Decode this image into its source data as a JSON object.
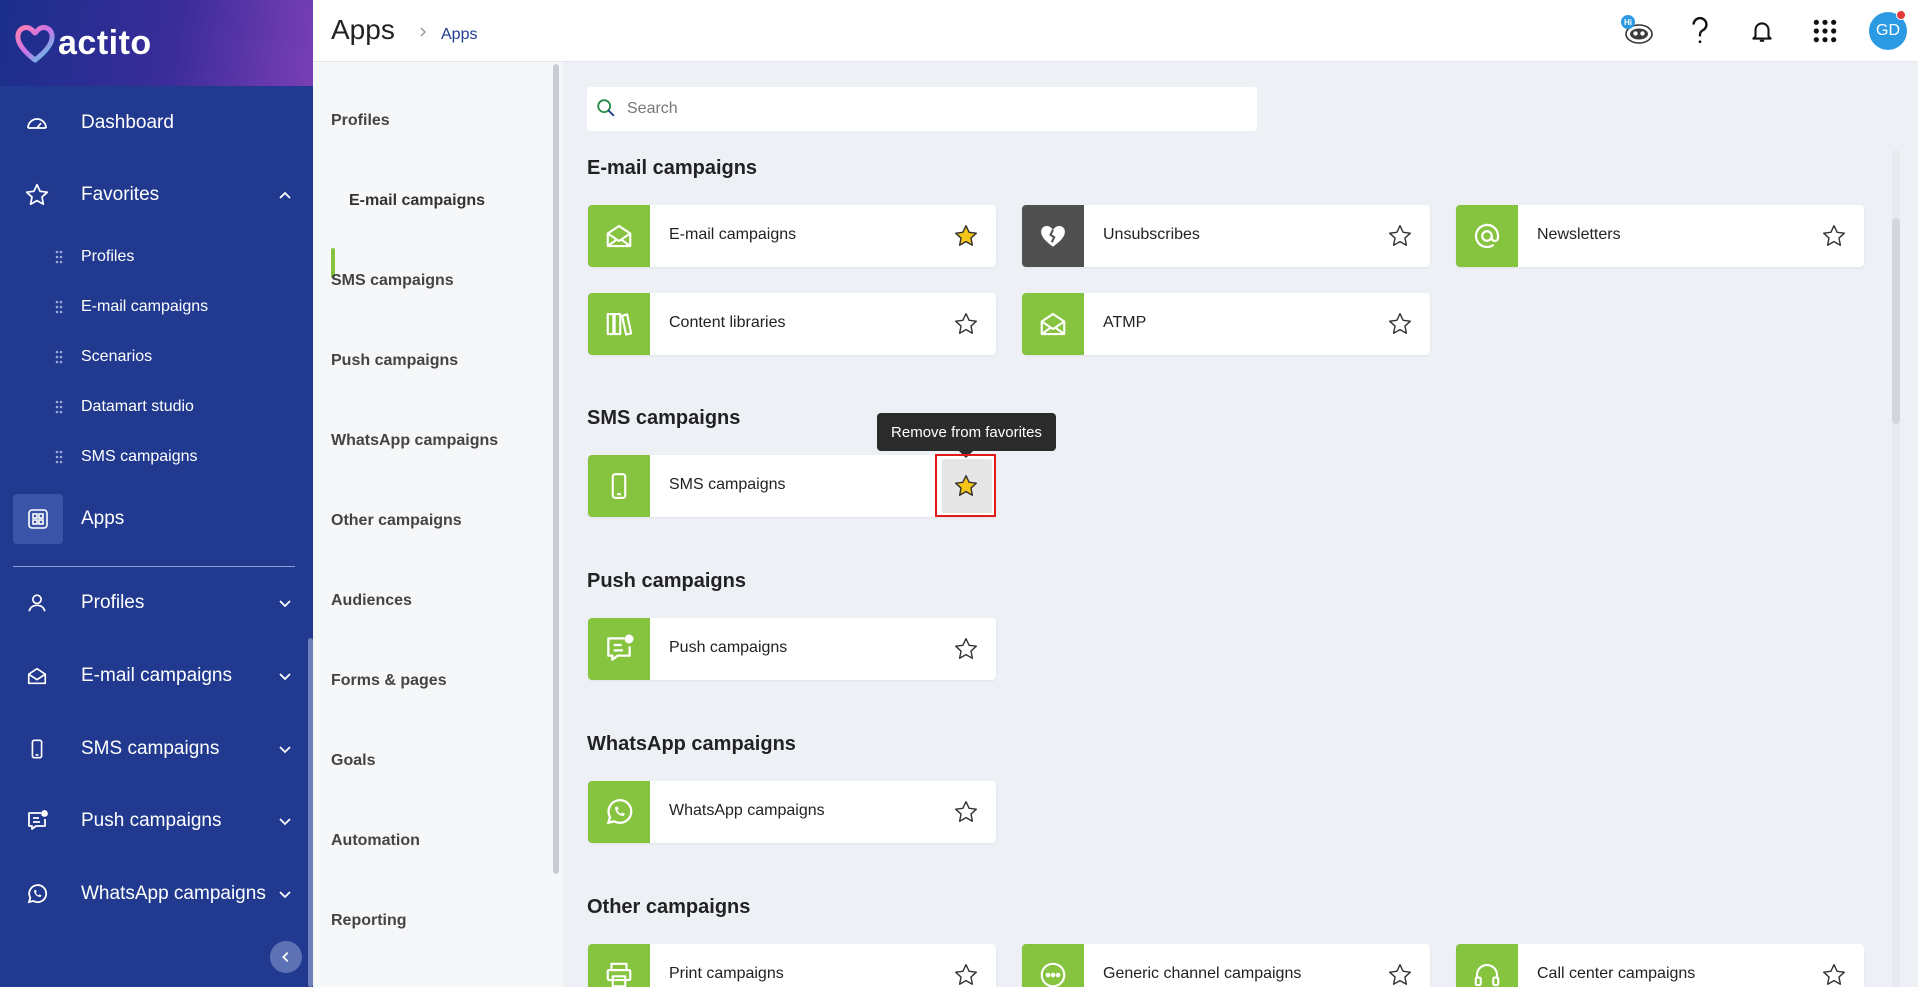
{
  "brand": {
    "name": "actito"
  },
  "colors": {
    "sidebar": "#213a8f",
    "accent_green": "#86c440",
    "avatar": "#2c9ae3",
    "tooltip": "#2b2b2b",
    "highlight_red": "#e01b1b",
    "star_fill": "#f5c518"
  },
  "sidebar": {
    "dashboard": {
      "label": "Dashboard",
      "icon": "gauge-icon"
    },
    "favorites": {
      "label": "Favorites",
      "icon": "star-icon",
      "expanded": true,
      "items": [
        {
          "label": "Profiles"
        },
        {
          "label": "E-mail campaigns"
        },
        {
          "label": "Scenarios"
        },
        {
          "label": "Datamart studio"
        },
        {
          "label": "SMS campaigns"
        }
      ]
    },
    "apps": {
      "label": "Apps",
      "icon": "apps-grid-icon"
    },
    "sections": [
      {
        "label": "Profiles",
        "icon": "user-icon"
      },
      {
        "label": "E-mail campaigns",
        "icon": "envelope-icon"
      },
      {
        "label": "SMS campaigns",
        "icon": "mobile-icon"
      },
      {
        "label": "Push campaigns",
        "icon": "push-message-icon"
      },
      {
        "label": "WhatsApp campaigns",
        "icon": "whatsapp-icon"
      }
    ]
  },
  "header": {
    "title": "Apps",
    "breadcrumb": "Apps",
    "avatar_initials": "GD",
    "badge_text": "Hi"
  },
  "categories": {
    "active": "E-mail campaigns",
    "items": [
      {
        "label": "Profiles"
      },
      {
        "label": "E-mail campaigns"
      },
      {
        "label": "SMS campaigns"
      },
      {
        "label": "Push campaigns"
      },
      {
        "label": "WhatsApp campaigns"
      },
      {
        "label": "Other campaigns"
      },
      {
        "label": "Audiences"
      },
      {
        "label": "Forms & pages"
      },
      {
        "label": "Goals"
      },
      {
        "label": "Automation"
      },
      {
        "label": "Reporting"
      }
    ]
  },
  "search": {
    "placeholder": "Search",
    "value": ""
  },
  "sections": {
    "email": {
      "title": "E-mail campaigns",
      "apps": [
        {
          "label": "E-mail campaigns",
          "icon": "envelope-icon",
          "favorite": true
        },
        {
          "label": "Unsubscribes",
          "icon": "broken-heart-icon",
          "favorite": false
        },
        {
          "label": "Newsletters",
          "icon": "at-sign-icon",
          "favorite": false
        },
        {
          "label": "Content libraries",
          "icon": "books-icon",
          "favorite": false
        },
        {
          "label": "ATMP",
          "icon": "envelope-icon",
          "favorite": false
        }
      ]
    },
    "sms": {
      "title": "SMS campaigns",
      "apps": [
        {
          "label": "SMS campaigns",
          "icon": "mobile-icon",
          "favorite": true
        }
      ]
    },
    "push": {
      "title": "Push campaigns",
      "apps": [
        {
          "label": "Push campaigns",
          "icon": "push-message-icon",
          "favorite": false
        }
      ]
    },
    "whatsapp": {
      "title": "WhatsApp campaigns",
      "apps": [
        {
          "label": "WhatsApp campaigns",
          "icon": "whatsapp-icon",
          "favorite": false
        }
      ]
    },
    "other": {
      "title": "Other campaigns",
      "apps": [
        {
          "label": "Print campaigns",
          "icon": "printer-icon",
          "favorite": false
        },
        {
          "label": "Generic channel campaigns",
          "icon": "chat-bubble-icon",
          "favorite": false
        },
        {
          "label": "Call center campaigns",
          "icon": "headset-icon",
          "favorite": false
        }
      ]
    }
  },
  "tooltip": {
    "text": "Remove from favorites"
  }
}
